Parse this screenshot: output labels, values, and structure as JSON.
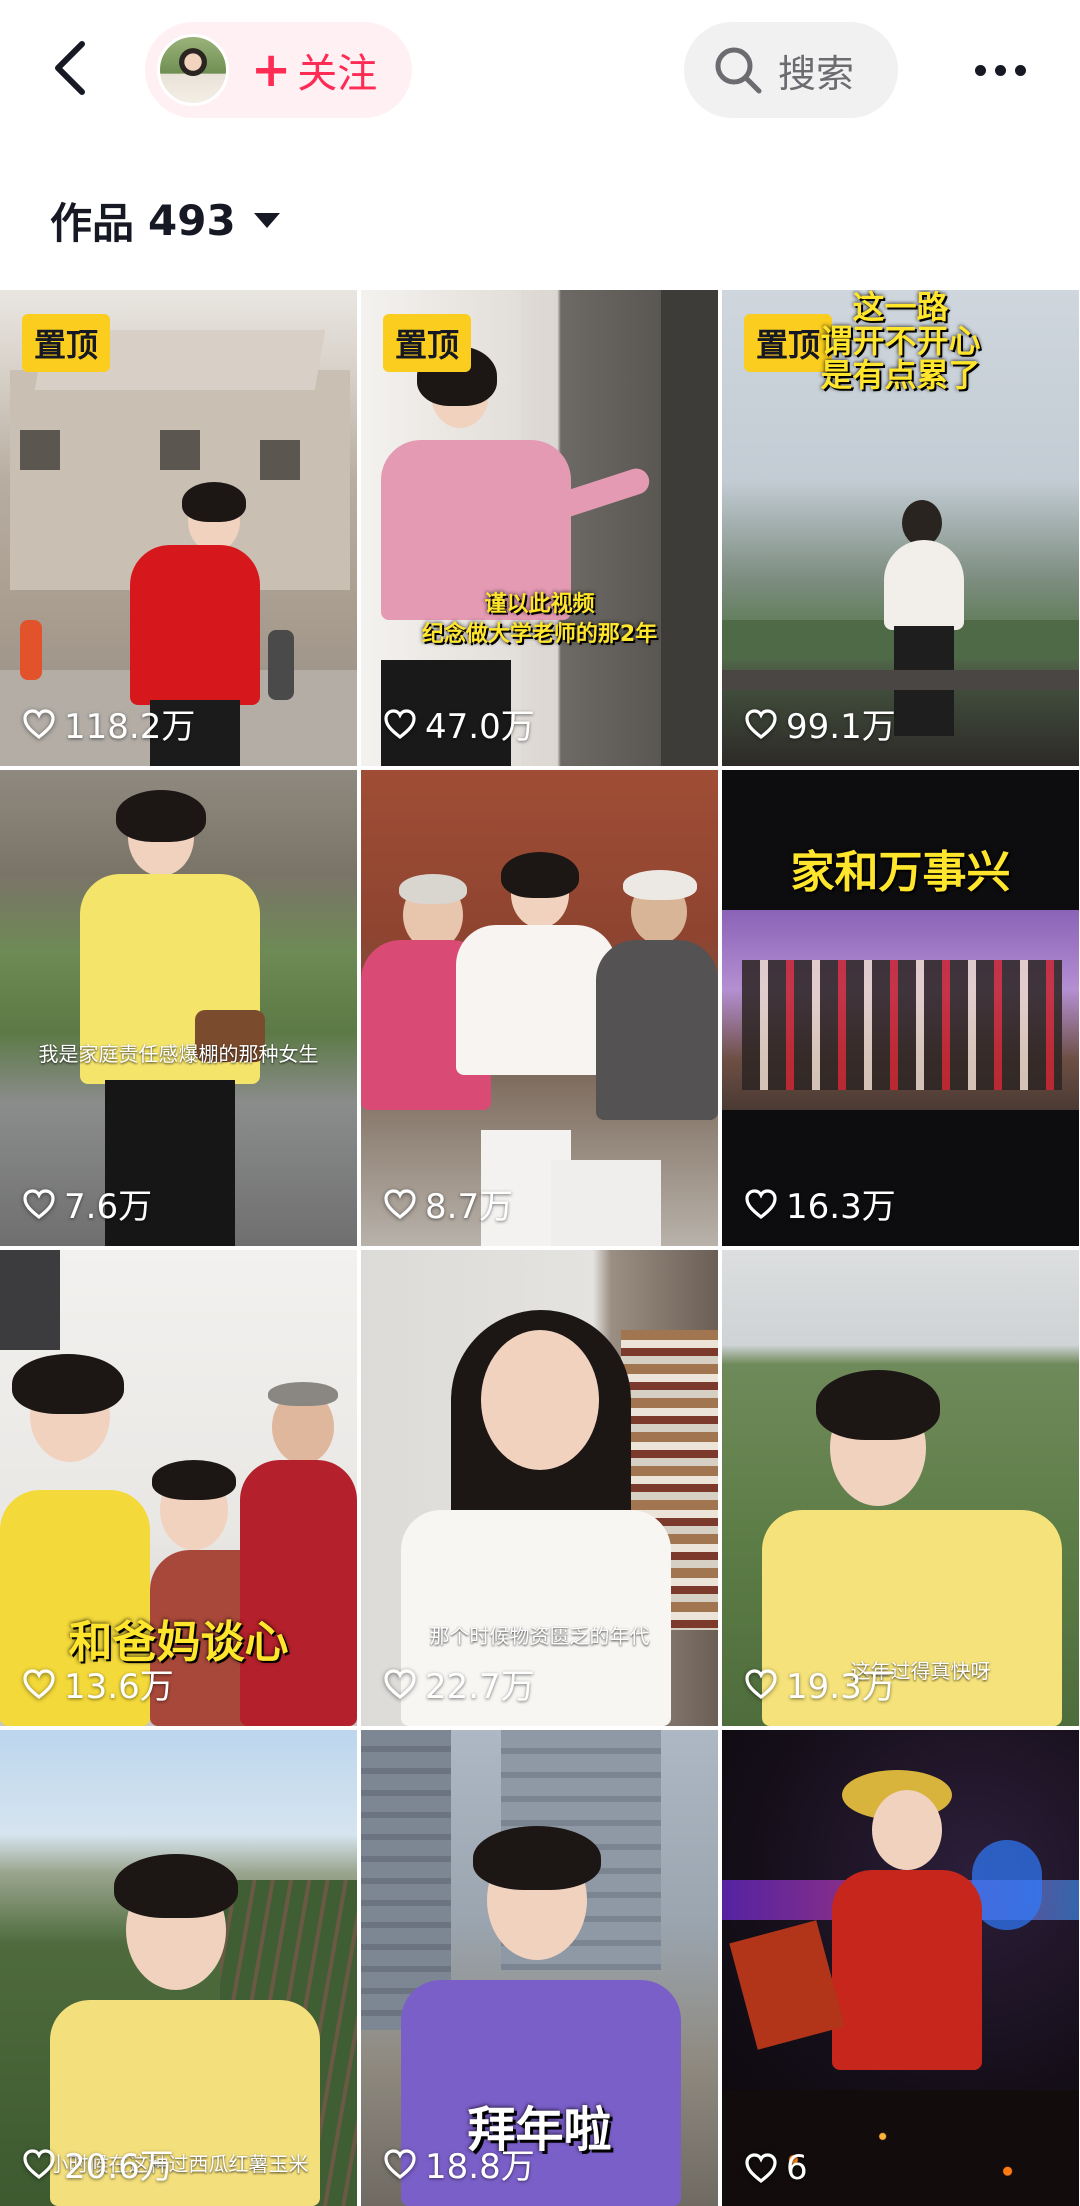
{
  "topbar": {
    "follow_label": "关注",
    "search_label": "搜索"
  },
  "works": {
    "label": "作品",
    "count": "493"
  },
  "colors": {
    "accent": "#fe2c55",
    "pin_badge": "#facd1e"
  },
  "videos": [
    {
      "pinned": true,
      "pin_label": "置顶",
      "likes": "118.2万"
    },
    {
      "pinned": true,
      "pin_label": "置顶",
      "likes": "47.0万",
      "caption_lines": [
        "谨以此视频",
        "纪念做大学老师的那2年"
      ]
    },
    {
      "pinned": true,
      "pin_label": "置顶",
      "likes": "99.1万",
      "caption_lines": [
        "这一路",
        "谓开不开心",
        "是有点累了"
      ]
    },
    {
      "pinned": false,
      "likes": "7.6万",
      "subtitle": "我是家庭责任感爆棚的那种女生"
    },
    {
      "pinned": false,
      "likes": "8.7万"
    },
    {
      "pinned": false,
      "likes": "16.3万",
      "caption": "家和万事兴"
    },
    {
      "pinned": false,
      "likes": "13.6万",
      "caption": "和爸妈谈心"
    },
    {
      "pinned": false,
      "likes": "22.7万",
      "subtitle": "那个时候物资匮乏的年代"
    },
    {
      "pinned": false,
      "likes": "19.3万",
      "subtitle": "这年过得真快呀"
    },
    {
      "pinned": false,
      "likes": "20.6万",
      "subtitle": "小时候在这种过西瓜红薯玉米"
    },
    {
      "pinned": false,
      "likes": "18.8万",
      "caption": "拜年啦"
    },
    {
      "pinned": false,
      "likes": "6"
    }
  ]
}
